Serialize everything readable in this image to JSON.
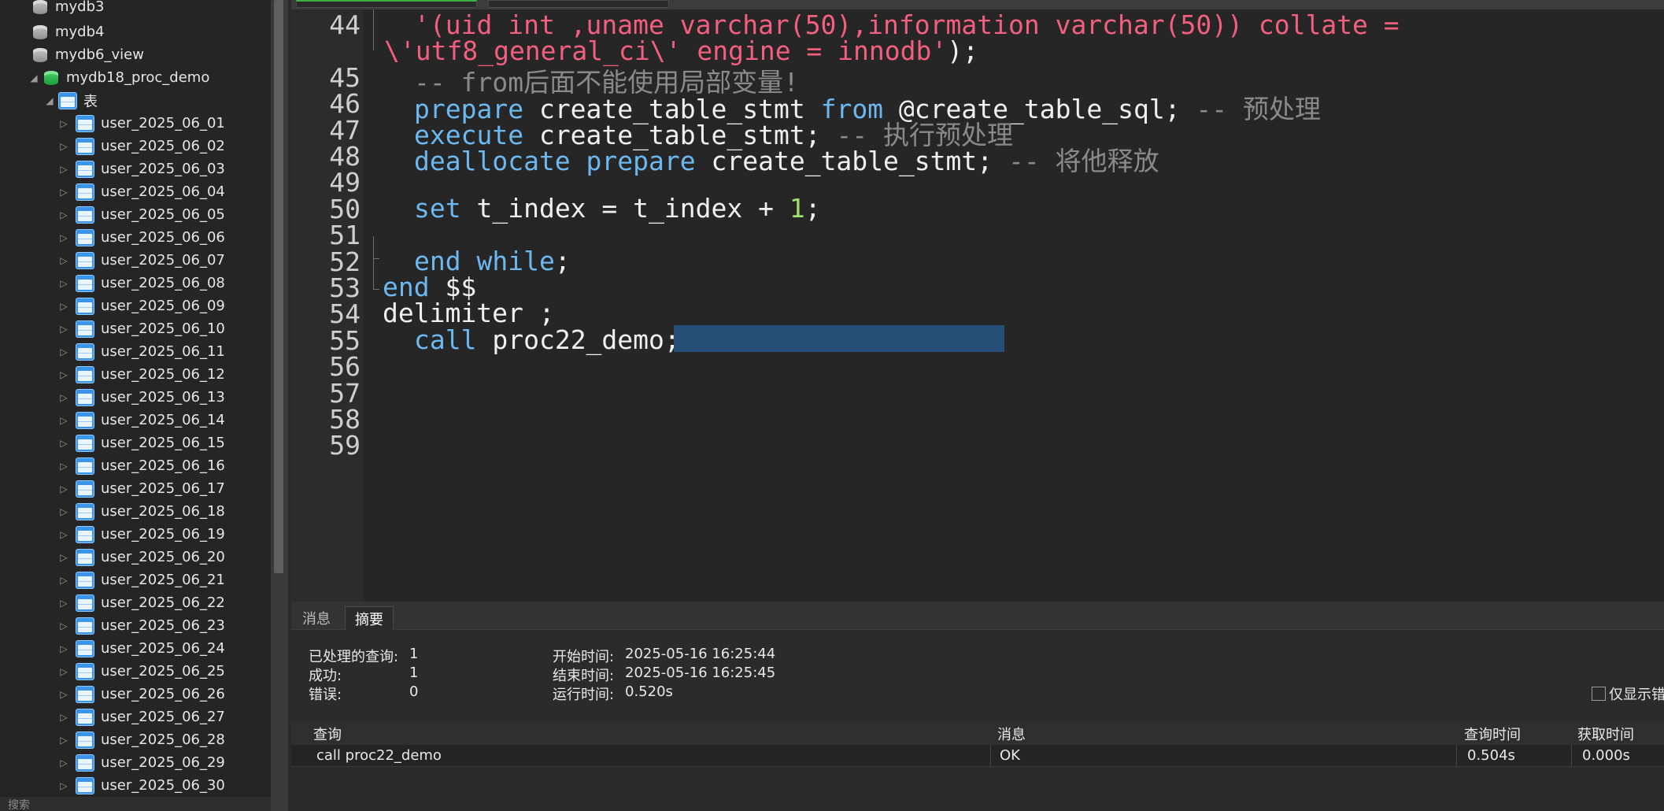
{
  "sidebar": {
    "databases": [
      {
        "label": "mydb3"
      },
      {
        "label": "mydb4"
      },
      {
        "label": "mydb6_view"
      },
      {
        "label": "mydb18_proc_demo"
      }
    ],
    "tables_folder": "表",
    "tables": [
      "user_2025_06_01",
      "user_2025_06_02",
      "user_2025_06_03",
      "user_2025_06_04",
      "user_2025_06_05",
      "user_2025_06_06",
      "user_2025_06_07",
      "user_2025_06_08",
      "user_2025_06_09",
      "user_2025_06_10",
      "user_2025_06_11",
      "user_2025_06_12",
      "user_2025_06_13",
      "user_2025_06_14",
      "user_2025_06_15",
      "user_2025_06_16",
      "user_2025_06_17",
      "user_2025_06_18",
      "user_2025_06_19",
      "user_2025_06_20",
      "user_2025_06_21",
      "user_2025_06_22",
      "user_2025_06_23",
      "user_2025_06_24",
      "user_2025_06_25",
      "user_2025_06_26",
      "user_2025_06_27",
      "user_2025_06_28",
      "user_2025_06_29",
      "user_2025_06_30"
    ],
    "search_placeholder": "搜索"
  },
  "editor": {
    "line_numbers": [
      "44",
      "",
      "45",
      "46",
      "47",
      "48",
      "49",
      "50",
      "51",
      "52",
      "53",
      "54",
      "55",
      "56",
      "57",
      "58",
      "59"
    ],
    "lines": {
      "l44a": "'(uid int ,uname varchar(50),information varchar(50)) collate =",
      "l44b": "\\'utf8_general_ci\\' engine = innodb'",
      "l44b_end": ");",
      "l45": "-- from后面不能使用局部变量!",
      "l46_kw": "prepare",
      "l46_mid": " create_table_stmt ",
      "l46_kw2": "from",
      "l46_rest": " @create_table_sql; ",
      "l46_cmt": "-- 预处理",
      "l47_kw": "execute",
      "l47_rest": " create_table_stmt; ",
      "l47_cmt": "-- 执行预处理",
      "l48_kw": "deallocate prepare",
      "l48_rest": " create_table_stmt; ",
      "l48_cmt": "-- 将他释放",
      "l50_kw": "set",
      "l50_rest": " t_index = t_index + ",
      "l50_num": "1",
      "l50_end": ";",
      "l52_kw": "end while",
      "l52_end": ";",
      "l53_kw": "end",
      "l53_rest": " $$",
      "l54": "delimiter ;",
      "l55_kw": "call",
      "l55_rest": " proc22_demo;"
    }
  },
  "panel": {
    "tabs": [
      "消息",
      "摘要"
    ],
    "active_tab": "摘要",
    "summary": {
      "processed_label": "已处理的查询:",
      "processed_value": "1",
      "success_label": "成功:",
      "success_value": "1",
      "error_label": "错误:",
      "error_value": "0",
      "start_label": "开始时间:",
      "start_value": "2025-05-16 16:25:44",
      "end_label": "结束时间:",
      "end_value": "2025-05-16 16:25:45",
      "runtime_label": "运行时间:",
      "runtime_value": "0.520s"
    },
    "only_errors_label": "仅显示错",
    "results": {
      "columns": [
        "查询",
        "消息",
        "查询时间",
        "获取时间"
      ],
      "rows": [
        {
          "query": "call proc22_demo",
          "message": "OK",
          "query_time": "0.504s",
          "fetch_time": "0.000s"
        }
      ]
    }
  },
  "colors": {
    "keyword": "#6cb8f0",
    "string": "#f35f7d",
    "comment": "#8a8a8a",
    "number": "#9fe070",
    "selection": "#264f78",
    "active_db_icon": "#1e9b3d",
    "table_icon": "#3a95e6"
  },
  "icons": {
    "database": "database-icon",
    "table": "table-icon",
    "expander_collapsed": "triangle-right-icon",
    "expander_expanded": "triangle-down-icon"
  }
}
